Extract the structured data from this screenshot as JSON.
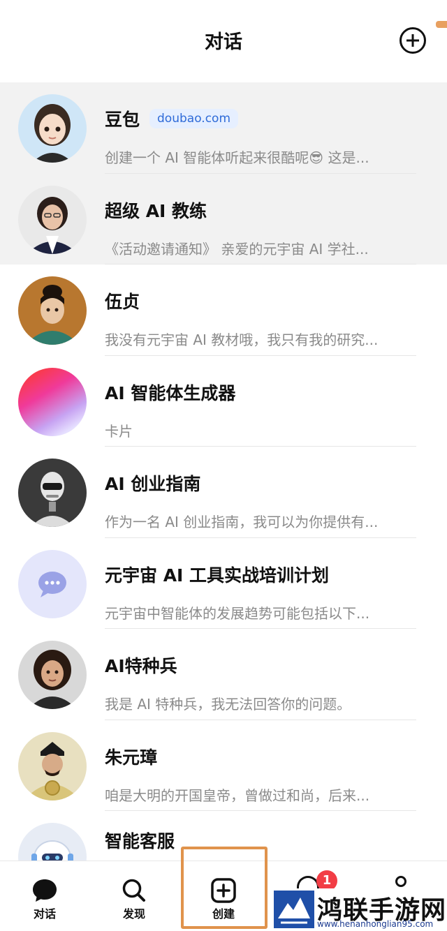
{
  "header": {
    "title": "对话",
    "add_icon": "plus-circle-icon"
  },
  "conversations": [
    {
      "name": "豆包",
      "tag": "doubao.com",
      "preview": "创建一个 AI 智能体听起来很酷呢😎 这是...",
      "pinned": true
    },
    {
      "name": "超级 AI 教练",
      "preview": "《活动邀请通知》 亲爱的元宇宙 AI 学社...",
      "pinned": true
    },
    {
      "name": "伍贞",
      "preview": "我没有元宇宙 AI 教材哦，我只有我的研究..."
    },
    {
      "name": "AI 智能体生成器",
      "preview": "卡片"
    },
    {
      "name": "AI 创业指南",
      "preview": "作为一名 AI 创业指南，我可以为你提供有..."
    },
    {
      "name": "元宇宙 AI 工具实战培训计划",
      "preview": "元宇宙中智能体的发展趋势可能包括以下..."
    },
    {
      "name": "AI特种兵",
      "preview": "我是 AI 特种兵，我无法回答你的问题。"
    },
    {
      "name": "朱元璋",
      "preview": "咱是大明的开国皇帝，曾做过和尚，后来..."
    },
    {
      "name": "智能客服",
      "preview": ""
    }
  ],
  "tabbar": {
    "tabs": [
      {
        "label": "对话",
        "icon": "chat-bubble-icon"
      },
      {
        "label": "发现",
        "icon": "search-icon"
      },
      {
        "label": "创建",
        "icon": "plus-square-icon"
      }
    ],
    "badge_count": "1"
  },
  "watermark": {
    "title": "鸿联手游网",
    "url": "www.henanhonglian95.com"
  },
  "colors": {
    "highlight": "#e0934c",
    "badge": "#f23d45",
    "tag_text": "#2f6bd8",
    "tag_bg": "#e6efff",
    "pinned_bg": "#f2f2f2"
  }
}
